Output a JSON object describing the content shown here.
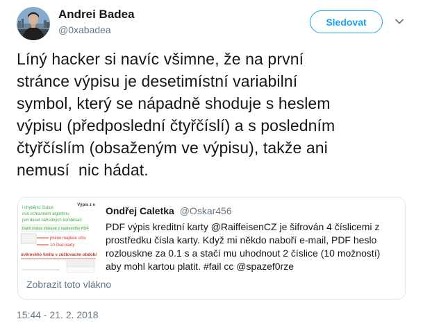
{
  "author": {
    "name": "Andrei Badea",
    "handle": "@0xabadea"
  },
  "follow_button": {
    "label": "Sledovat"
  },
  "icons": {
    "avatar": "avatar-photo",
    "menu": "chevron-down-icon"
  },
  "tweet": {
    "lines": [
      "Líný hacker si navíc všimne, že na první",
      "stránce výpisu je desetimístní variabilní",
      "symbol, který se nápadně shoduje s heslem",
      "výpisu (předposlední čtyřčíslí) a s posledním",
      "čtyřčíslím (obsaženým ve výpisu), takže ani",
      "nemusí  nic hádat."
    ]
  },
  "quoted_tweet": {
    "name": "Ondřej Caletka",
    "handle": "@Oskar456",
    "lines": [
      "PDF výpis kreditní karty @RaiffeisenCZ je šifrován 4 číslicemi z",
      "prostředku čísla karty. Když mi někdo naboří e-mail, PDF heslo",
      "rozlouskne za 0.1 s a stačí mu uhodnout 2 číslice (10 možností)",
      "aby mohl kartou platit. #fail cc @spazef0rze"
    ],
    "show_thread": "Zobrazit toto vlákno",
    "thumbnail": {
      "lines": [
        "i chybějící číslice",
        "ová ochranném algoritmu",
        "jsm deset náhodných kombinací",
        "Další číslice získané z nadresního PDF",
        "jméno majitele účtu",
        "10 čísel karty",
        "úvěrového limitu v zúčtovacím období",
        "Výpis z e"
      ]
    }
  },
  "timestamp": "15:44 - 21. 2. 2018",
  "colors": {
    "accent": "#1da1f2",
    "text": "#14171a",
    "muted": "#657786",
    "border": "#e1e8ed",
    "annotation_red": "#e0302a",
    "annotation_green": "#3aa93a"
  }
}
